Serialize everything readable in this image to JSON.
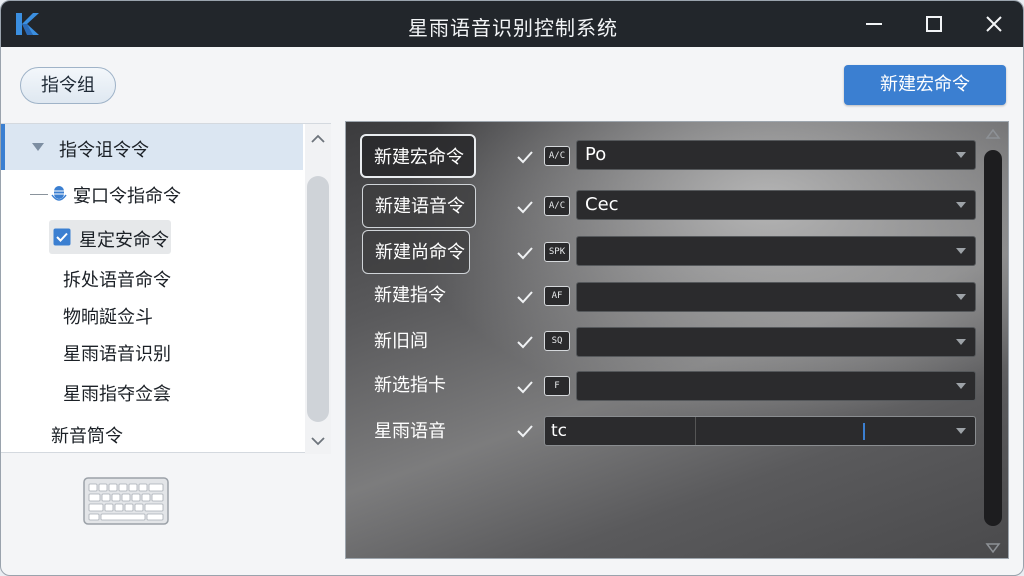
{
  "window": {
    "title": "星雨语音识别控制系统",
    "accent_color": "#3b7fd1",
    "titlebar_color": "#22262b"
  },
  "toolbar": {
    "group_button": "指令组",
    "new_macro_button": "新建宏命令"
  },
  "tree": {
    "root_label": "指令诅令令",
    "group_label": "宴口令指命令",
    "checked_item": "星定安命令",
    "items": [
      "拆处语音命令",
      "物晌誕佥斗",
      "星雨语音识别",
      "星雨指夺佥侌"
    ],
    "bottom_item": "新音筒令"
  },
  "commands": [
    {
      "label": "新建宏命令",
      "icon": "A/C",
      "value": ""
    },
    {
      "label": "新建语音令",
      "icon": "A/C",
      "value": ""
    },
    {
      "label": "新建尚命令",
      "icon": "SPK",
      "value": ""
    },
    {
      "label": "新建指令",
      "icon": "AF",
      "value": ""
    },
    {
      "label": "新旧闾",
      "icon": "SQ",
      "value": ""
    },
    {
      "label": "新选指卡",
      "icon": "F",
      "value": ""
    },
    {
      "label": "星雨语音",
      "icon": "",
      "value": ""
    }
  ],
  "command_values": [
    "Po",
    "Cec",
    "",
    "",
    "",
    "",
    "tc"
  ],
  "icons": {
    "logo": "k-logo-icon",
    "minimize": "minimize-icon",
    "maximize": "maximize-icon",
    "close": "close-icon",
    "keyboard": "keyboard-icon"
  }
}
